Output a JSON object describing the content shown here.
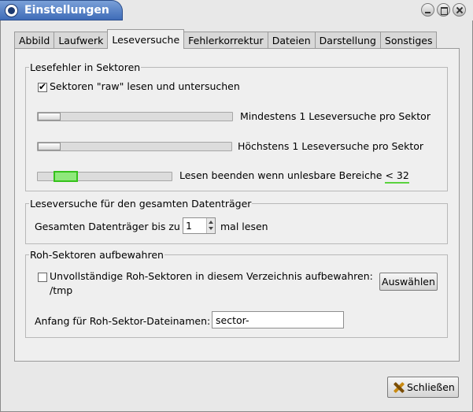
{
  "window": {
    "title": "Einstellungen"
  },
  "tabs": [
    {
      "label": "Abbild"
    },
    {
      "label": "Laufwerk"
    },
    {
      "label": "Leseversuche",
      "active": true
    },
    {
      "label": "Fehlerkorrektur"
    },
    {
      "label": "Dateien"
    },
    {
      "label": "Darstellung"
    },
    {
      "label": "Sonstiges"
    }
  ],
  "sector_errors": {
    "legend": "Lesefehler in Sektoren",
    "raw_checkbox": {
      "label": "Sektoren \"raw\" lesen und untersuchen",
      "checked": true
    },
    "min_slider": {
      "label": "Mindestens 1 Leseversuche pro Sektor",
      "value_fraction": 0.0
    },
    "max_slider": {
      "label": "Höchstens 1 Leseversuche pro Sektor",
      "value_fraction": 0.0
    },
    "stop_slider": {
      "label_prefix": "Lesen beenden wenn unlesbare Bereiche",
      "label_value": "< 32",
      "value_fraction": 0.2
    }
  },
  "medium_retries": {
    "legend": "Leseversuche für den gesamten Datenträger",
    "label_before": "Gesamten Datenträger bis zu",
    "value": "1",
    "label_after": "mal lesen"
  },
  "raw_sectors": {
    "legend": "Roh-Sektoren aufbewahren",
    "keep_checkbox": {
      "label": "Unvollständige Roh-Sektoren in diesem Verzeichnis aufbewahren:",
      "checked": false
    },
    "path": "/tmp",
    "choose_button": "Auswählen",
    "prefix_label": "Anfang für Roh-Sektor-Dateinamen:",
    "prefix_value": "sector-"
  },
  "footer": {
    "close_button": "Schließen"
  }
}
